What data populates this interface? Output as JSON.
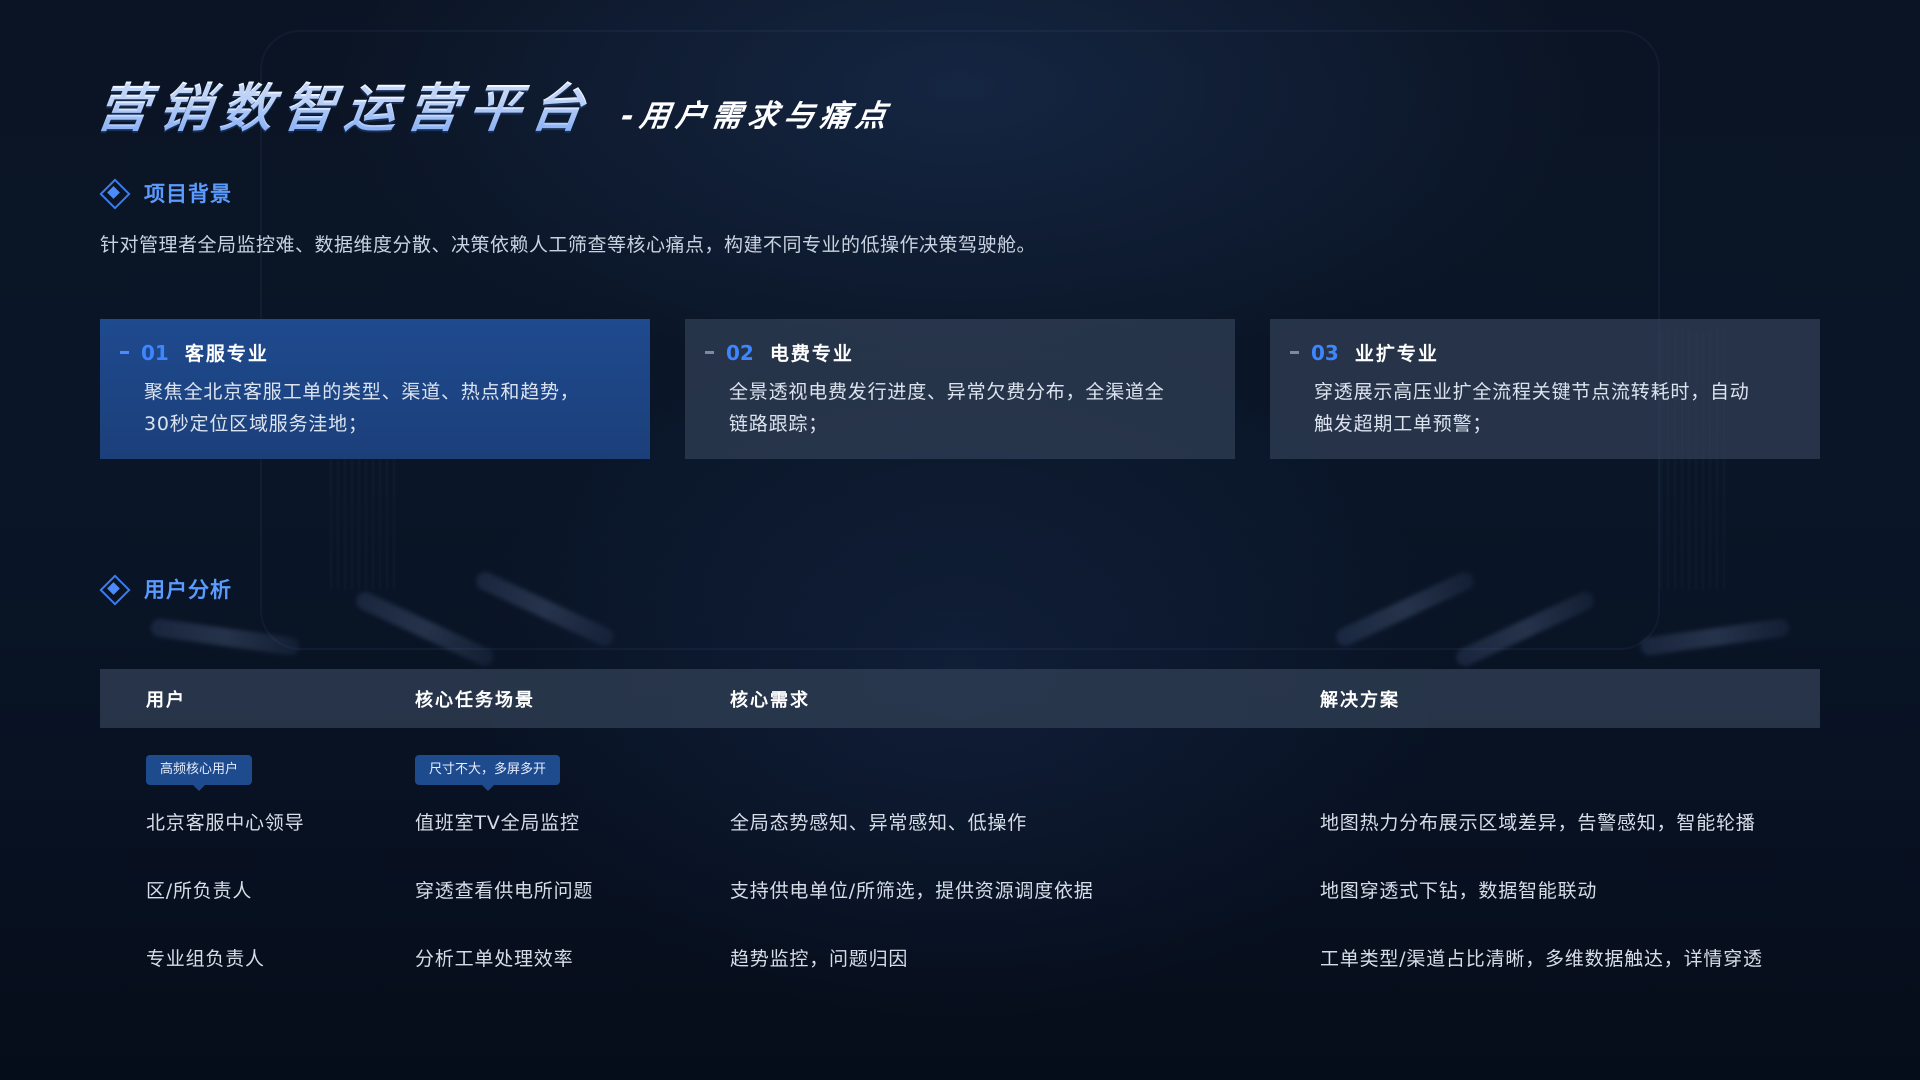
{
  "header": {
    "title": "营销数智运营平台",
    "subtitle": "-用户需求与痛点"
  },
  "background_section": {
    "title": "项目背景",
    "text": "针对管理者全局监控难、数据维度分散、决策依赖人工筛查等核心痛点，构建不同专业的低操作决策驾驶舱。",
    "cards": [
      {
        "num": "01",
        "name": "客服专业",
        "desc_line1": "聚焦全北京客服工单的类型、渠道、热点和趋势，",
        "desc_line2": "30秒定位区域服务洼地；",
        "active": true
      },
      {
        "num": "02",
        "name": "电费专业",
        "desc_line1": "全景透视电费发行进度、异常欠费分布，全渠道全",
        "desc_line2": "链路跟踪；",
        "active": false
      },
      {
        "num": "03",
        "name": "业扩专业",
        "desc_line1": "穿透展示高压业扩全流程关键节点流转耗时，自动",
        "desc_line2": "触发超期工单预警；",
        "active": false
      }
    ]
  },
  "analysis_section": {
    "title": "用户分析",
    "columns": [
      "用户",
      "核心任务场景",
      "核心需求",
      "解决方案"
    ],
    "tags": {
      "user": "高频核心用户",
      "scene": "尺寸不大，多屏多开"
    },
    "rows": [
      {
        "user": "北京客服中心领导",
        "scene": "值班室TV全局监控",
        "need": "全局态势感知、异常感知、低操作",
        "solution": "地图热力分布展示区域差异，告警感知，智能轮播"
      },
      {
        "user": "区/所负责人",
        "scene": "穿透查看供电所问题",
        "need": "支持供电单位/所筛选，提供资源调度依据",
        "solution": "地图穿透式下钻，数据智能联动"
      },
      {
        "user": "专业组负责人",
        "scene": "分析工单处理效率",
        "need": "趋势监控，问题归因",
        "solution": "工单类型/渠道占比清晰，多维数据触达，详情穿透"
      }
    ]
  },
  "colors": {
    "accent": "#3d86ff",
    "card_active": "#1e4a8e",
    "background": "#0a1628"
  }
}
